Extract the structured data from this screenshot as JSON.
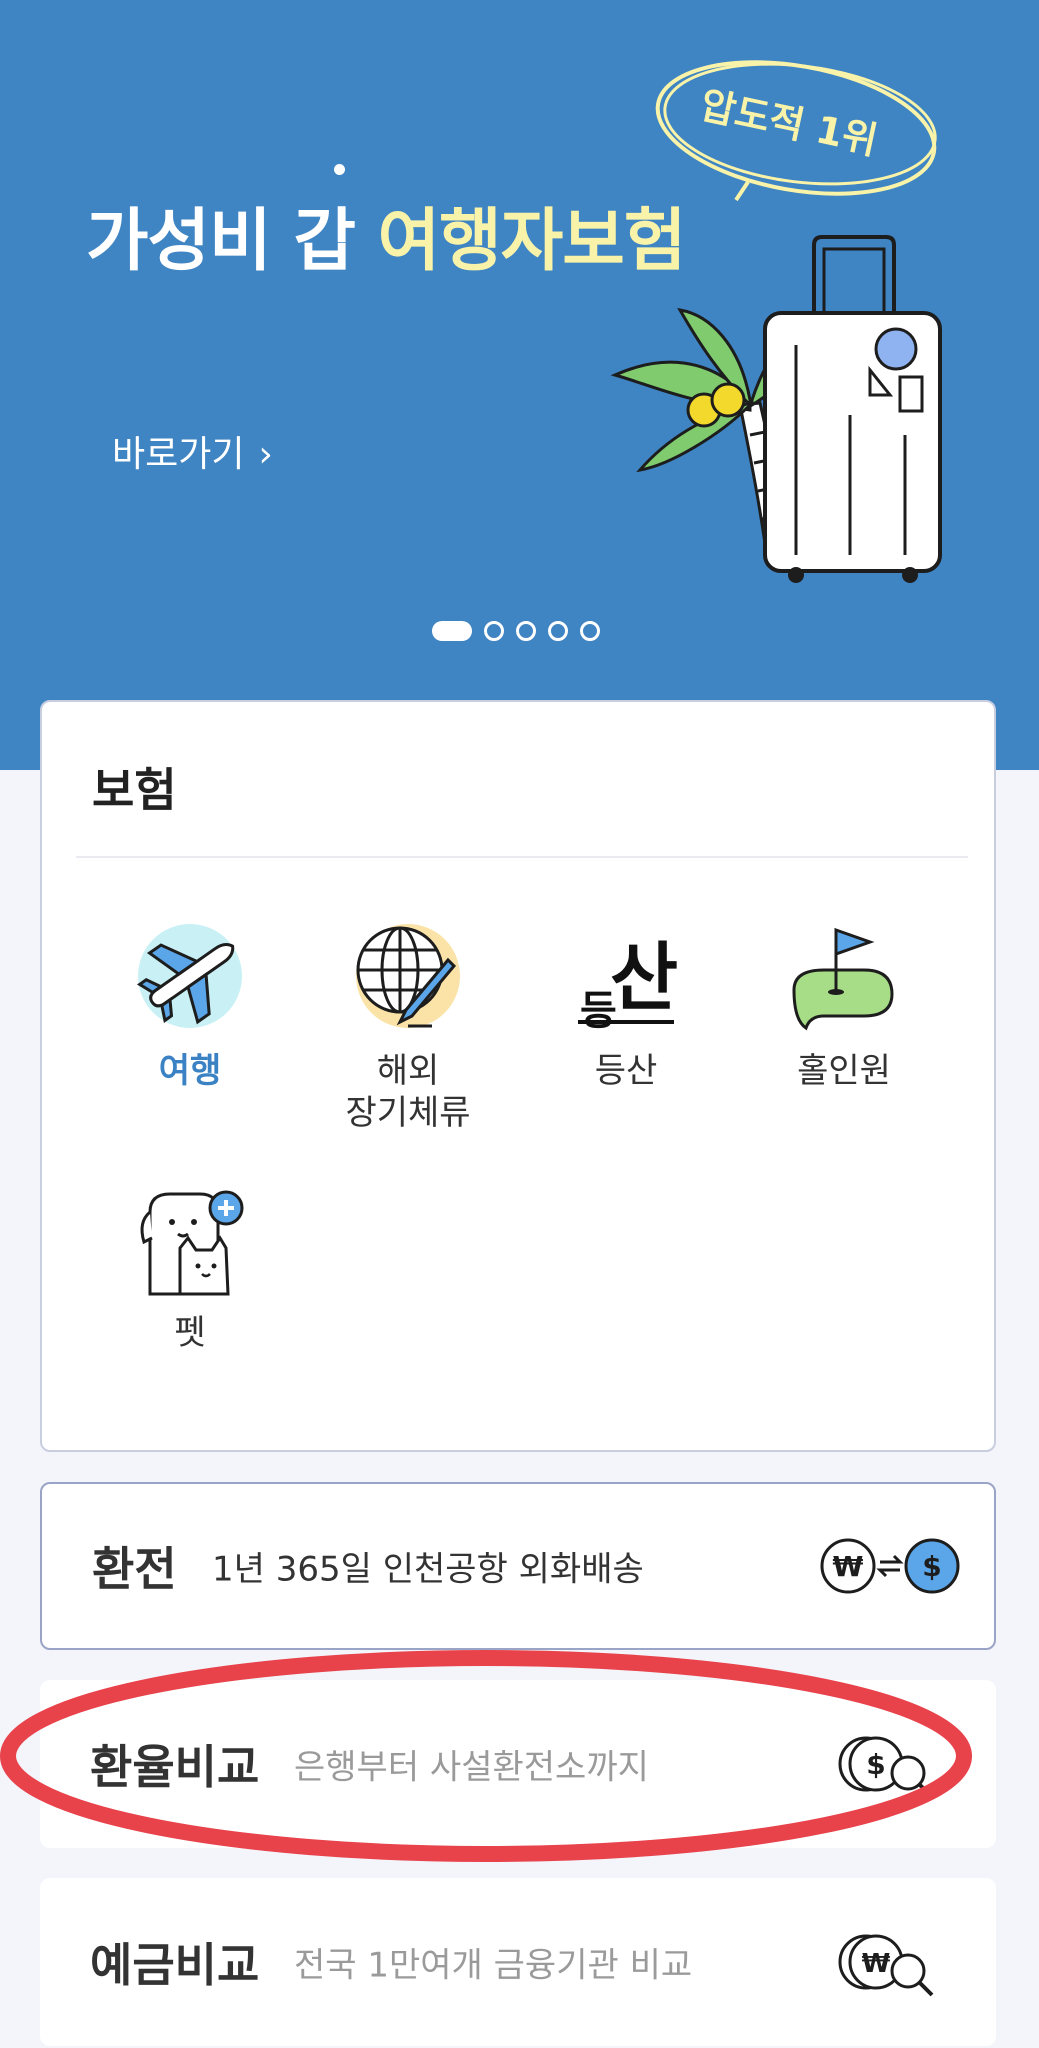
{
  "banner": {
    "title_plain": "가성비 갑 ",
    "title_highlight": "여행자보험",
    "badge_text": "압도적 1위",
    "shortcut_label": "바로가기",
    "shortcut_chevron": "›",
    "pager_total": 5,
    "pager_active": 1,
    "colors": {
      "background": "#3f84c3",
      "highlight": "#f8f3a8"
    }
  },
  "insurance": {
    "title": "보험",
    "items": [
      {
        "label": "여행",
        "icon": "airplane-icon",
        "active": true
      },
      {
        "label": "해외\n장기체류",
        "icon": "globe-pen-icon",
        "active": false
      },
      {
        "label": "등산",
        "icon": "mountain-text-icon",
        "icon_text_big": "산",
        "icon_text_small": "등",
        "active": false
      },
      {
        "label": "홀인원",
        "icon": "golf-flag-icon",
        "active": false
      },
      {
        "label": "펫",
        "icon": "pet-icon",
        "active": false
      }
    ],
    "accent_color": "#3b82c4"
  },
  "exchange": {
    "title": "환전",
    "desc": "1년 365일 인천공항 외화배송",
    "icon": "won-to-dollar-icon"
  },
  "rate_compare": {
    "title": "환율비교",
    "desc": "은행부터 사설환전소까지",
    "icon": "dollar-search-icon",
    "annotation_color": "#e8424b"
  },
  "deposit_compare": {
    "title": "예금비교",
    "desc": "전국 1만여개 금융기관 비교",
    "icon": "won-search-icon"
  }
}
